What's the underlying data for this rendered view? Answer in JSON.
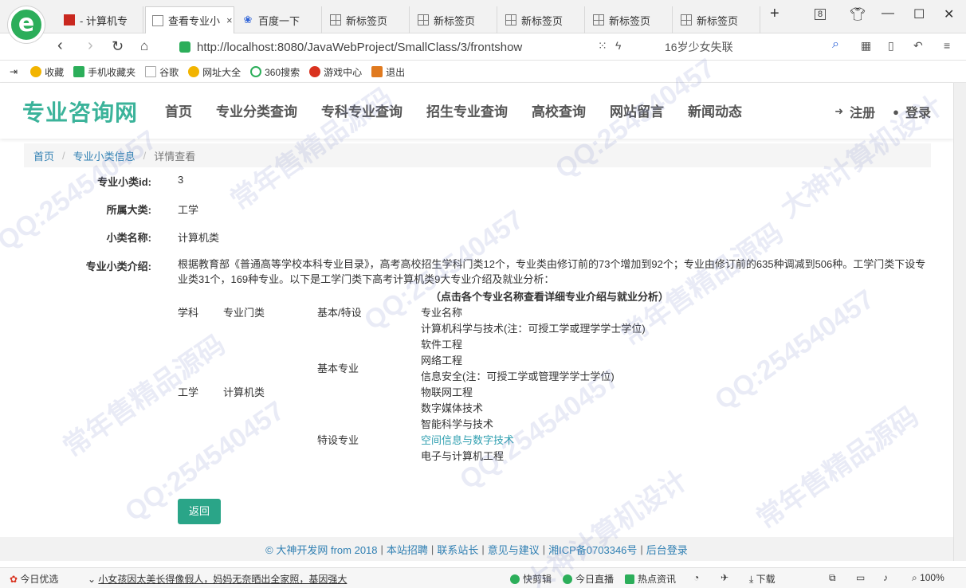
{
  "browser": {
    "logo_letter": "e",
    "tabs": [
      {
        "label": "- 计算机专",
        "icon": "red-square-icon"
      },
      {
        "label": "查看专业小",
        "icon": "document-icon",
        "close": "×"
      },
      {
        "label": "百度一下",
        "icon": "baidu-paw-icon"
      },
      {
        "label": "新标签页",
        "icon": "grid-icon"
      },
      {
        "label": "新标签页",
        "icon": "grid-icon"
      },
      {
        "label": "新标签页",
        "icon": "grid-icon"
      },
      {
        "label": "新标签页",
        "icon": "grid-icon"
      },
      {
        "label": "新标签页",
        "icon": "grid-icon"
      }
    ],
    "new_tab": "+",
    "tab_count": "8",
    "url": "http://localhost:8080/JavaWebProject/SmallClass/3/frontshow",
    "search_text": "16岁少女失联",
    "bookmarks": [
      {
        "label": "收藏",
        "color": "#f2b400"
      },
      {
        "label": "手机收藏夹",
        "color": "#2cae5a"
      },
      {
        "label": "谷歌",
        "color": "#dddddd"
      },
      {
        "label": "网址大全",
        "color": "#f2b400"
      },
      {
        "label": "360搜索",
        "color": "#2cae5a"
      },
      {
        "label": "游戏中心",
        "color": "#d9321f"
      },
      {
        "label": "退出",
        "color": "#e07a1f"
      }
    ]
  },
  "site": {
    "logo": "专业咨询网",
    "nav": [
      "首页",
      "专业分类查询",
      "专科专业查询",
      "招生专业查询",
      "高校查询",
      "网站留言",
      "新闻动态"
    ],
    "register": "注册",
    "login": "登录",
    "accent_color": "#3bb39a"
  },
  "breadcrumb": {
    "home": "首页",
    "section": "专业小类信息",
    "current": "详情查看",
    "sep": "/"
  },
  "detail": {
    "id_label": "专业小类id:",
    "id_value": "3",
    "category_label": "所属大类:",
    "category_value": "工学",
    "name_label": "小类名称:",
    "name_value": "计算机类",
    "intro_label": "专业小类介绍:",
    "intro_text": "根据教育部《普通高等学校本科专业目录》，高考高校招生学科门类12个，专业类由修订前的73个增加到92个；专业由修订前的635种调减到506种。工学门类下设专业类31个，169种专业。以下是工学门类下高考计算机类9大专业介绍及就业分析：",
    "table_note": "（点击各个专业名称查看详细专业介绍与就业分析）",
    "table_headers": [
      "学科",
      "专业门类",
      "基本/特设",
      "专业名称"
    ],
    "subject": "工学",
    "category": "计算机类",
    "basic_label": "基本专业",
    "special_label": "特设专业",
    "majors": [
      "计算机科学与技术(注：可授工学或理学学士学位)",
      "软件工程",
      "网络工程",
      "信息安全(注：可授工学或管理学学士学位)",
      "物联网工程",
      "数字媒体技术",
      "智能科学与技术",
      "空间信息与数字技术",
      "电子与计算机工程"
    ],
    "back_button": "返回"
  },
  "footer": {
    "items": [
      "© 大神开发网 from 2018",
      "本站招聘",
      "联系站长",
      "意见与建议",
      "湘ICP备0703346号",
      "后台登录"
    ],
    "sep": "|"
  },
  "statusbar": {
    "today": "今日优选",
    "news": "小女孩因太美长得像假人，妈妈无奈晒出全家照，基因强大",
    "quick_edit": "快剪辑",
    "live": "今日直播",
    "hot": "热点资讯",
    "download": "下载",
    "zoom": "100%"
  },
  "watermarks": [
    "QQ:254540457",
    "常年售精品源码",
    "大神计算机设计"
  ]
}
